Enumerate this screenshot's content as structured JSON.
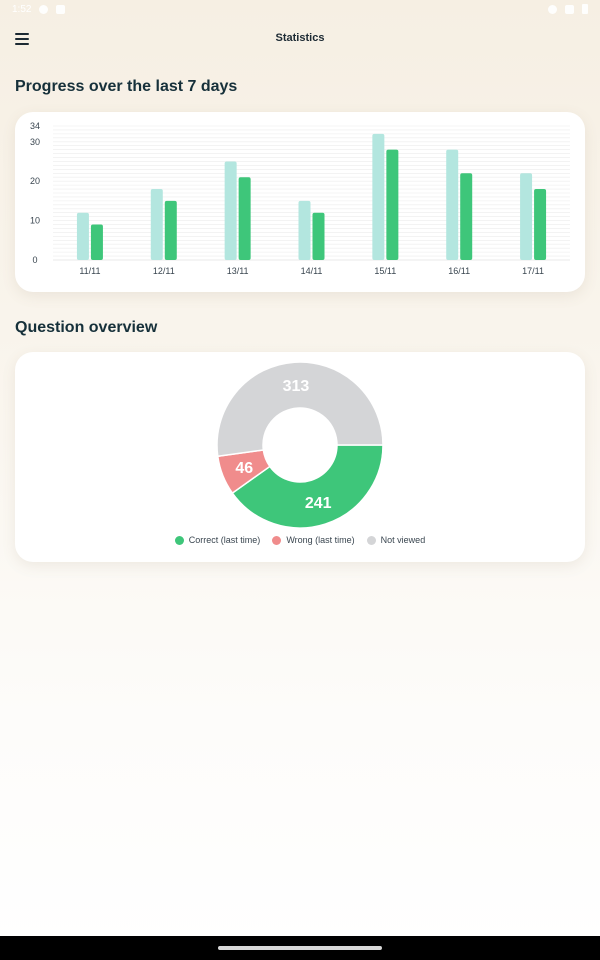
{
  "status_bar": {
    "time": "1:52"
  },
  "app_bar": {
    "title": "Statistics"
  },
  "progress_section": {
    "title": "Progress over the last 7 days"
  },
  "overview_section": {
    "title": "Question overview"
  },
  "colors": {
    "accent_green": "#3ec67a",
    "light_teal": "#b3e6df",
    "wrong_red": "#f08c8c",
    "not_viewed_grey": "#d4d5d7"
  },
  "chart_data": [
    {
      "type": "bar",
      "categories": [
        "11/11",
        "12/11",
        "13/11",
        "14/11",
        "15/11",
        "16/11",
        "17/11"
      ],
      "series": [
        {
          "values": [
            12,
            18,
            25,
            15,
            32,
            28,
            22
          ]
        },
        {
          "values": [
            9,
            15,
            21,
            12,
            28,
            22,
            18
          ]
        }
      ],
      "yticks": [
        0,
        10,
        20,
        30,
        34
      ],
      "ylim": [
        0,
        34
      ],
      "grid": true
    },
    {
      "type": "pie",
      "donut": true,
      "labels": [
        "Correct (last time)",
        "Wrong (last time)",
        "Not viewed"
      ],
      "values": [
        241,
        46,
        313
      ],
      "legend_position": "bottom"
    }
  ],
  "icons": {
    "menu": "hamburger-menu-icon"
  }
}
